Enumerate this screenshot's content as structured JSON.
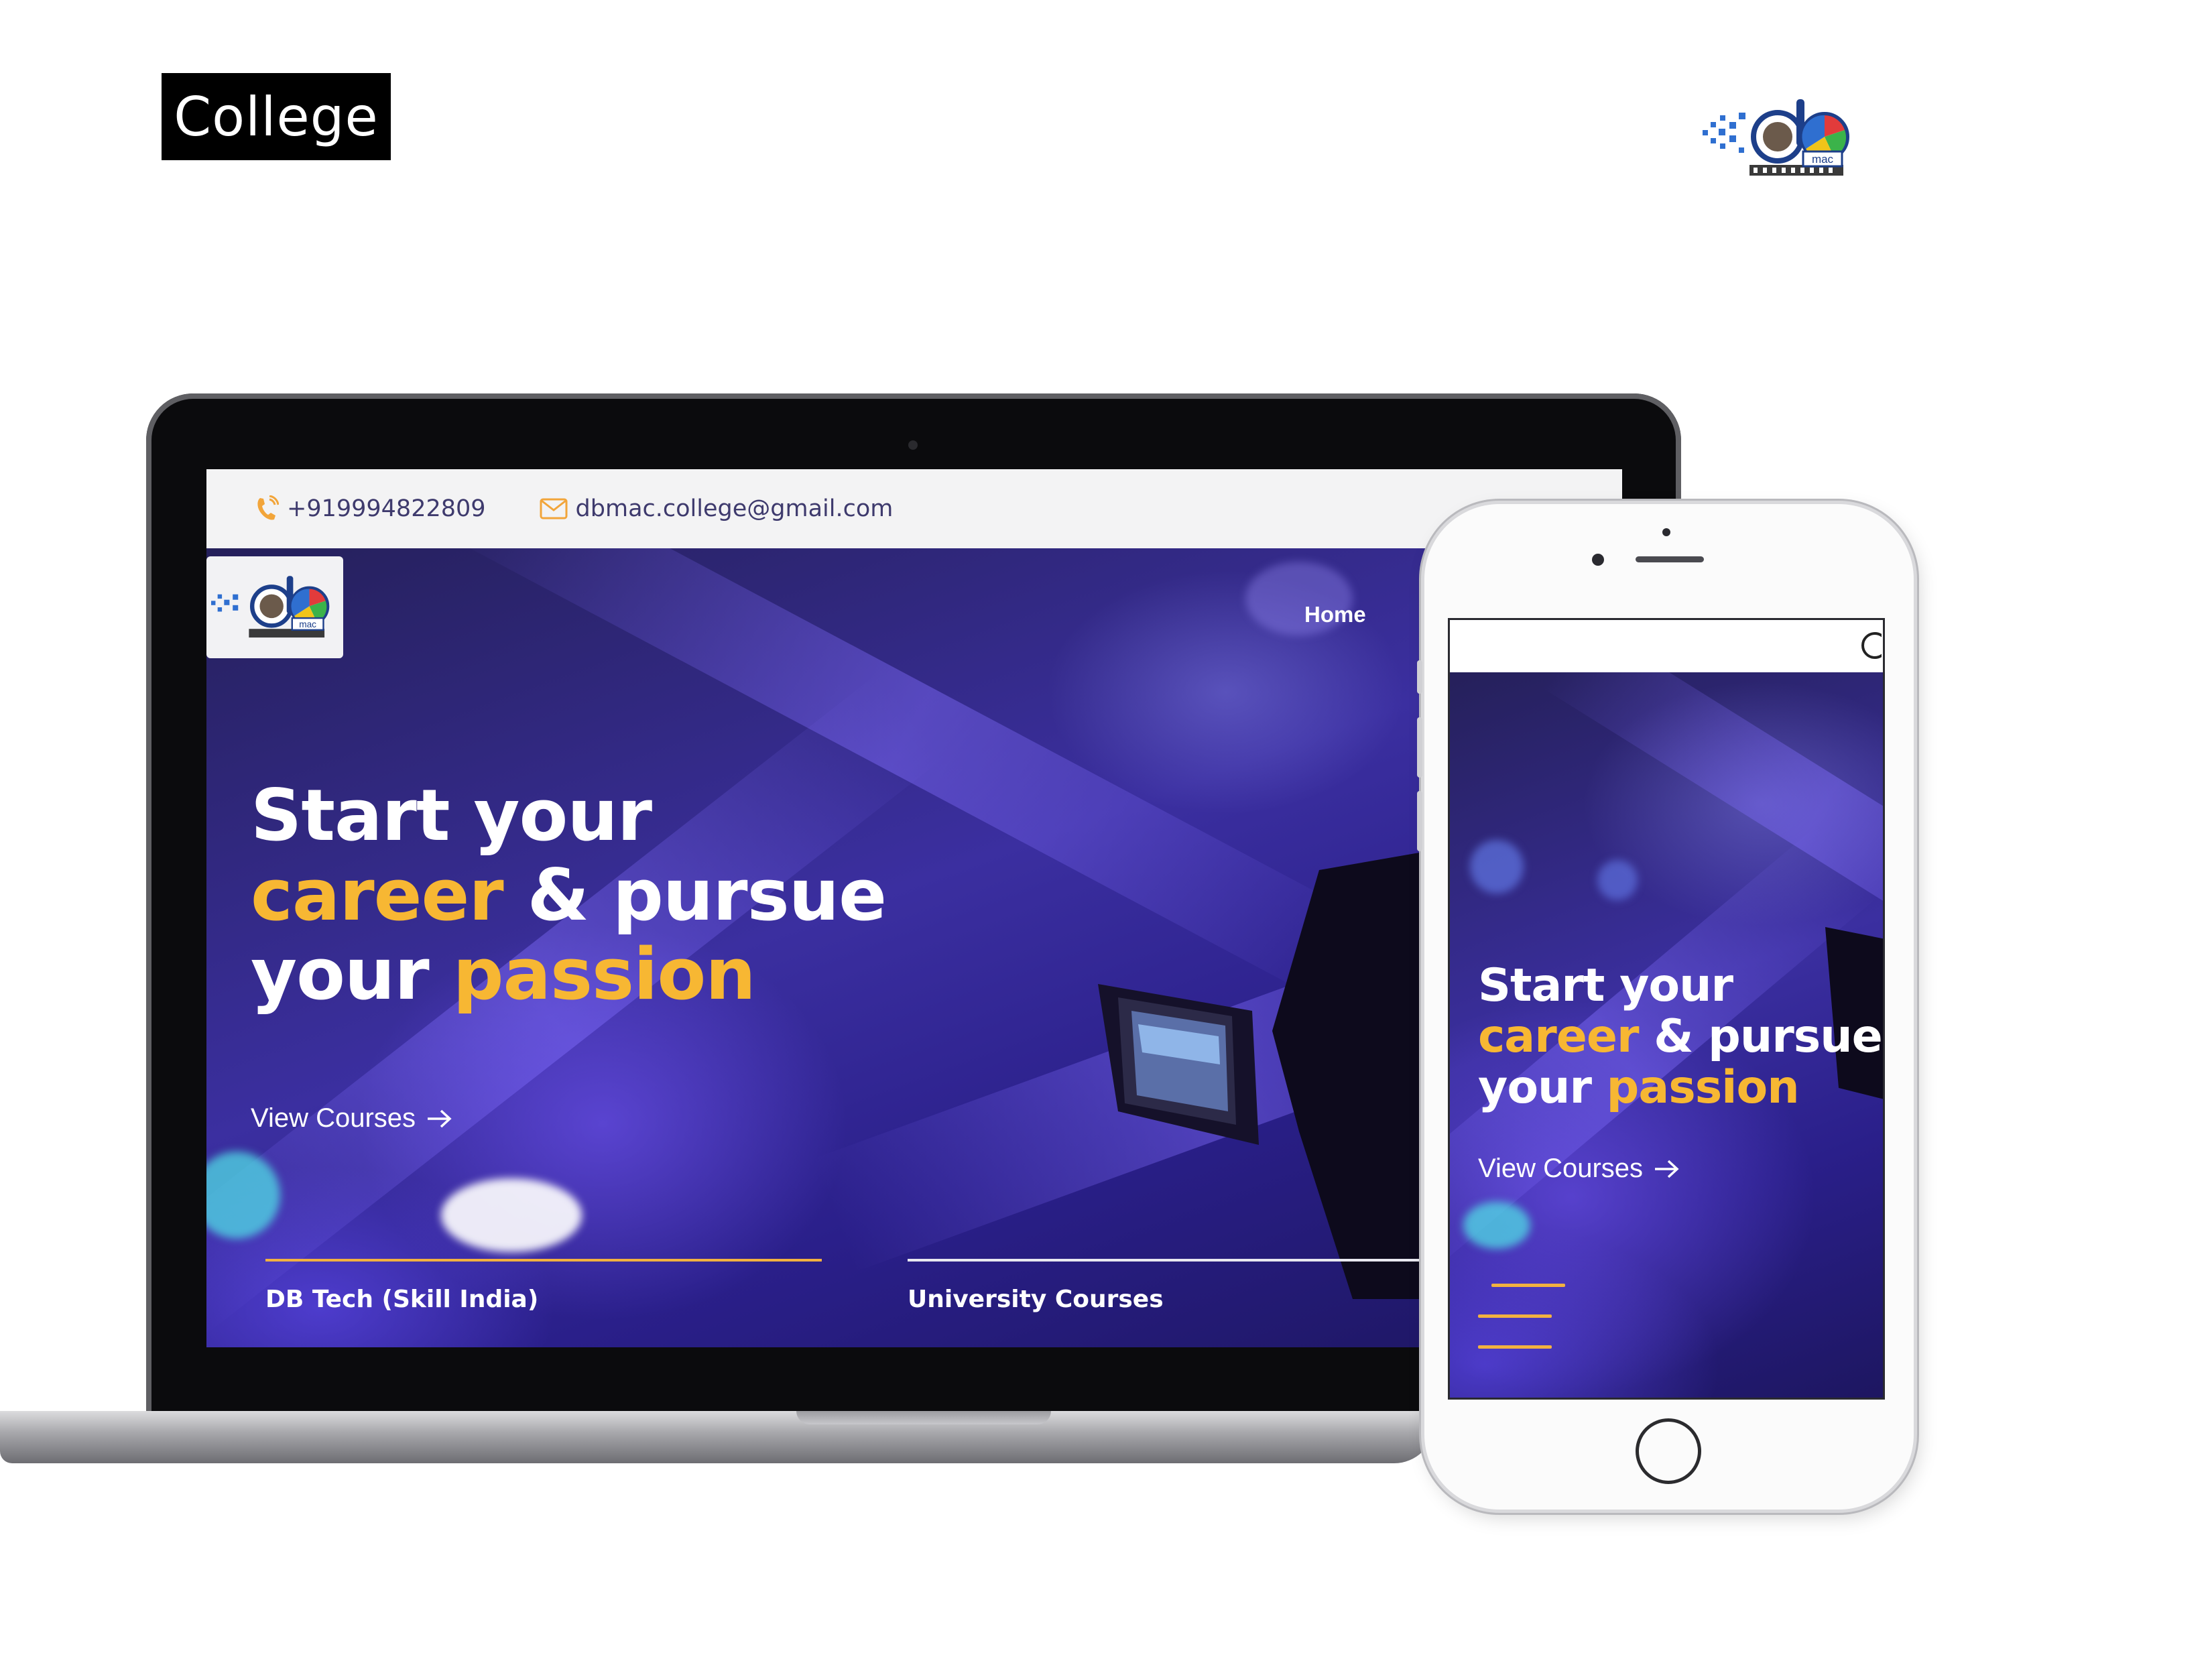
{
  "label": {
    "text": "College"
  },
  "brand": {
    "logo_text": "mac"
  },
  "site": {
    "contact": {
      "phone": "+919994822809",
      "email": "dbmac.college@gmail.com"
    },
    "nav": {
      "home": "Home"
    },
    "hero": {
      "line1": "Start your",
      "line2_highlight": "career",
      "line2_rest": " & pursue",
      "line3_start": "your ",
      "line3_highlight": "passion",
      "cta": "View Courses"
    },
    "categories": [
      "DB Tech (Skill India)",
      "University Courses"
    ]
  },
  "mobile": {
    "hero": {
      "line1": "Start your",
      "line2_highlight": "career",
      "line2_rest": " & pursue",
      "line3_start": "your ",
      "line3_highlight": "passion",
      "cta": "View Courses"
    }
  },
  "colors": {
    "accent": "#f7b733",
    "hero_base": "#2a1f8a",
    "contact_text": "#3e3a6d"
  },
  "icons": [
    "phone-icon",
    "mail-icon",
    "arrow-right-icon",
    "search-icon",
    "hamburger-menu-icon",
    "brand-logo-icon"
  ]
}
